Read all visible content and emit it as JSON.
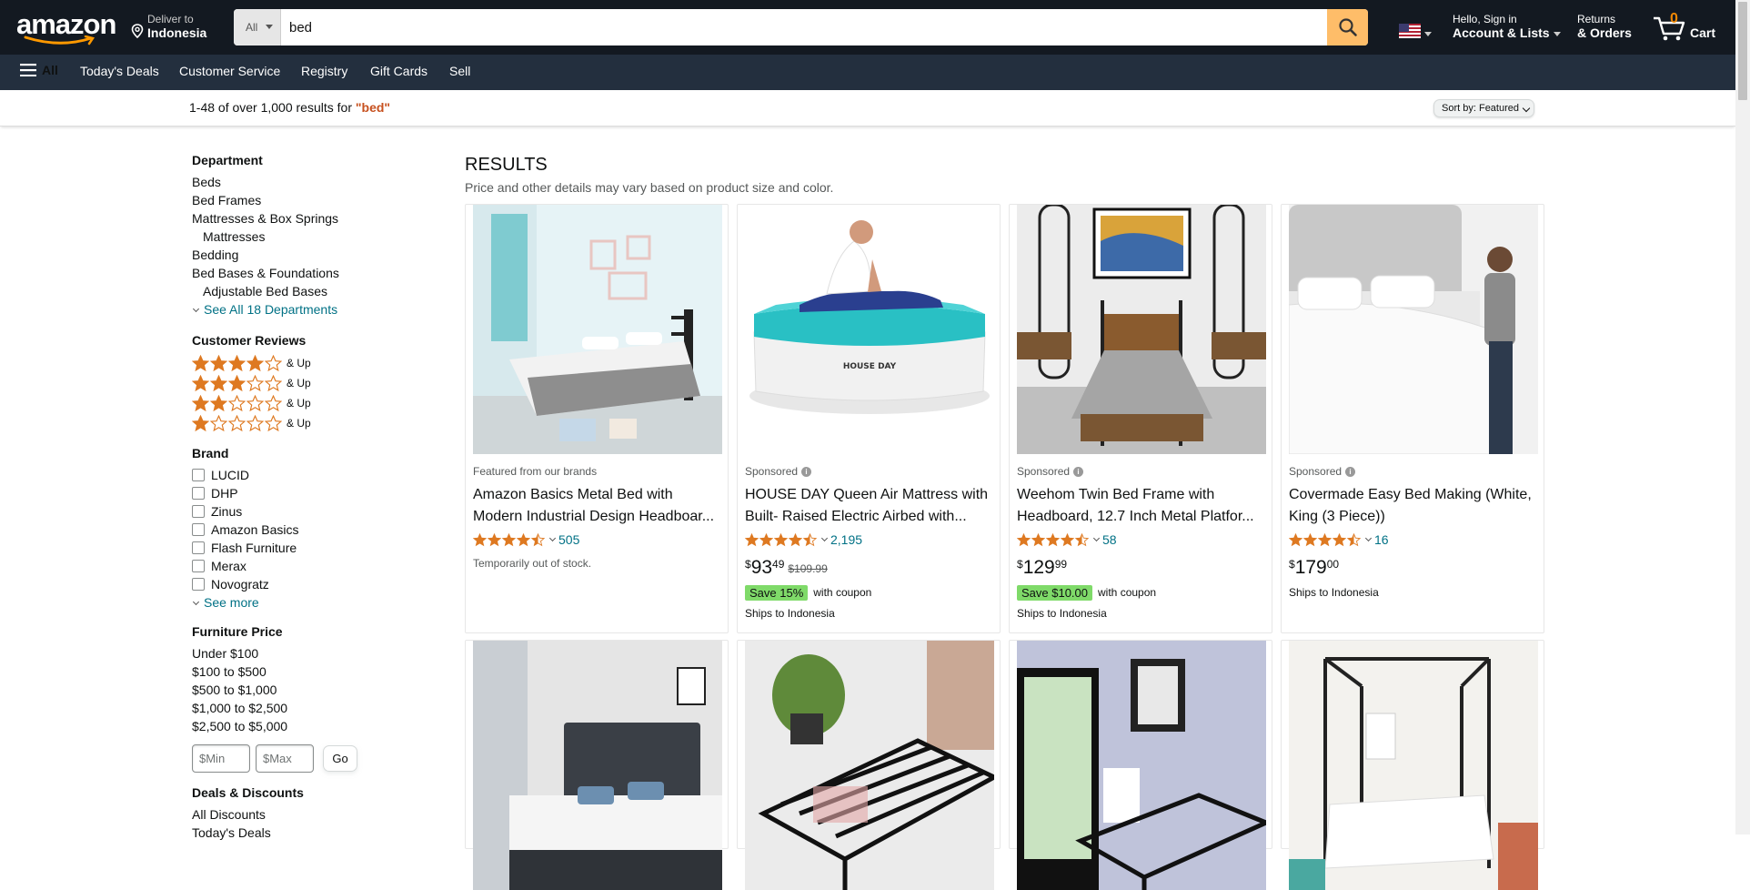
{
  "header": {
    "logo": "amazon",
    "deliver_line1": "Deliver to",
    "deliver_line2": "Indonesia",
    "search_category": "All",
    "search_value": "bed",
    "account_line1": "Hello, Sign in",
    "account_line2": "Account & Lists",
    "returns_line1": "Returns",
    "returns_line2": "& Orders",
    "cart_count": "0",
    "cart_label": "Cart"
  },
  "nav": {
    "all_label": "All",
    "links": [
      "Today's Deals",
      "Customer Service",
      "Registry",
      "Gift Cards",
      "Sell"
    ]
  },
  "subbar": {
    "count_text": "1-48 of over 1,000 results for ",
    "query": "\"bed\"",
    "sort_label": "Sort by:",
    "sort_value": "Featured"
  },
  "sidebar": {
    "department_title": "Department",
    "departments": [
      "Beds",
      "Bed Frames",
      "Mattresses & Box Springs",
      "Mattresses",
      "Bedding",
      "Bed Bases & Foundations",
      "Adjustable Bed Bases"
    ],
    "see_all_departments": "See All 18 Departments",
    "reviews_title": "Customer Reviews",
    "review_rows": [
      4,
      3,
      2,
      1
    ],
    "and_up": "& Up",
    "brand_title": "Brand",
    "brands": [
      "LUCID",
      "DHP",
      "Zinus",
      "Amazon Basics",
      "Flash Furniture",
      "Merax",
      "Novogratz"
    ],
    "see_more": "See more",
    "price_title": "Furniture Price",
    "price_ranges": [
      "Under $100",
      "$100 to $500",
      "$500 to $1,000",
      "$1,000 to $2,500",
      "$2,500 to $5,000"
    ],
    "min_placeholder": "$Min",
    "max_placeholder": "$Max",
    "go_label": "Go",
    "deals_title": "Deals & Discounts",
    "deals": [
      "All Discounts",
      "Today's Deals"
    ]
  },
  "results": {
    "heading": "RESULTS",
    "subheading": "Price and other details may vary based on product size and color.",
    "products": [
      {
        "tag": "Featured from our brands",
        "title": "Amazon Basics Metal Bed with Modern Industrial Design Headboar...",
        "rating": 4.5,
        "reviews": "505",
        "out_of_stock": "Temporarily out of stock."
      },
      {
        "tag": "Sponsored",
        "title": "HOUSE DAY Queen Air Mattress with Built- Raised Electric Airbed with...",
        "rating": 4.5,
        "reviews": "2,195",
        "price_symbol": "$",
        "price_whole": "93",
        "price_frac": "49",
        "price_old": "$109.99",
        "coupon": "Save 15%",
        "coupon_suffix": "with coupon",
        "ships": "Ships to Indonesia",
        "brand_print": "HOUSE DAY"
      },
      {
        "tag": "Sponsored",
        "title": "Weehom Twin Bed Frame with Headboard, 12.7 Inch Metal Platfor...",
        "rating": 4.5,
        "reviews": "58",
        "price_symbol": "$",
        "price_whole": "129",
        "price_frac": "99",
        "coupon": "Save $10.00",
        "coupon_suffix": "with coupon",
        "ships": "Ships to Indonesia"
      },
      {
        "tag": "Sponsored",
        "title": "Covermade Easy Bed Making (White, King (3 Piece))",
        "rating": 4.5,
        "reviews": "16",
        "price_symbol": "$",
        "price_whole": "179",
        "price_frac": "00",
        "ships": "Ships to Indonesia"
      }
    ]
  },
  "colors": {
    "topbar": "#131921",
    "navbar": "#232f3e",
    "search_button": "#febd69",
    "star": "#de7921",
    "link": "#007185",
    "coupon": "#7fda69",
    "query": "#c7511f"
  }
}
